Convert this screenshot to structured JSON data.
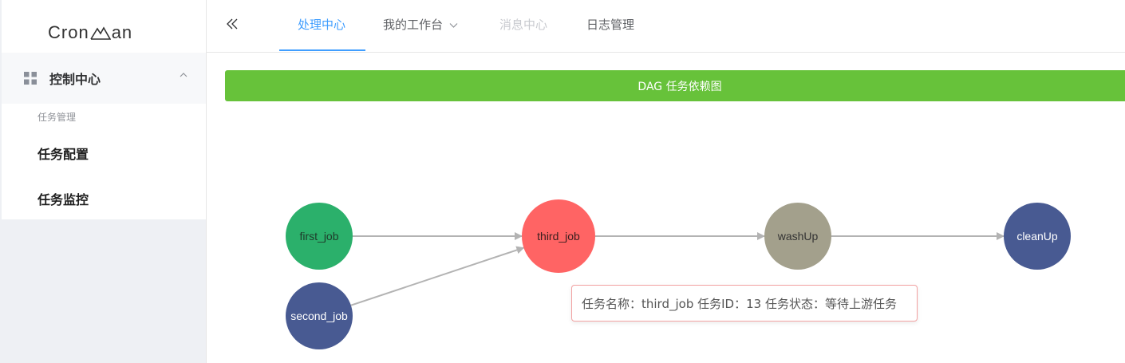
{
  "app": {
    "logo_text_left": "Cron",
    "logo_text_right": "an"
  },
  "sidebar": {
    "group_title": "控制中心",
    "sub_caption": "任务管理",
    "items": [
      {
        "label": "任务配置"
      },
      {
        "label": "任务监控"
      }
    ]
  },
  "header": {
    "tabs": [
      {
        "label": "处理中心",
        "state": "active"
      },
      {
        "label": "我的工作台",
        "state": "dropdown"
      },
      {
        "label": "消息中心",
        "state": "disabled"
      },
      {
        "label": "日志管理",
        "state": "normal"
      }
    ]
  },
  "banner": {
    "title": "DAG 任务依赖图"
  },
  "dag": {
    "nodes": [
      {
        "id": "first_job",
        "label": "first_job",
        "color": "#2bb06b",
        "text_color": "#1f3a2a"
      },
      {
        "id": "second_job",
        "label": "second_job",
        "color": "#485a92",
        "text_color": "#ffffff"
      },
      {
        "id": "third_job",
        "label": "third_job",
        "color": "#ff6464",
        "text_color": "#3a1f1f"
      },
      {
        "id": "washUp",
        "label": "washUp",
        "color": "#a3a08c",
        "text_color": "#333333"
      },
      {
        "id": "cleanUp",
        "label": "cleanUp",
        "color": "#485a92",
        "text_color": "#ffffff"
      }
    ],
    "edges": [
      {
        "from": "first_job",
        "to": "third_job"
      },
      {
        "from": "second_job",
        "to": "third_job"
      },
      {
        "from": "third_job",
        "to": "washUp"
      },
      {
        "from": "washUp",
        "to": "cleanUp"
      }
    ],
    "edge_color": "#b3b3b3"
  },
  "tooltip": {
    "text": "任务名称：third_job 任务ID：13 任务状态：等待上游任务"
  },
  "colors": {
    "accent": "#409eff",
    "banner": "#67c23a"
  }
}
